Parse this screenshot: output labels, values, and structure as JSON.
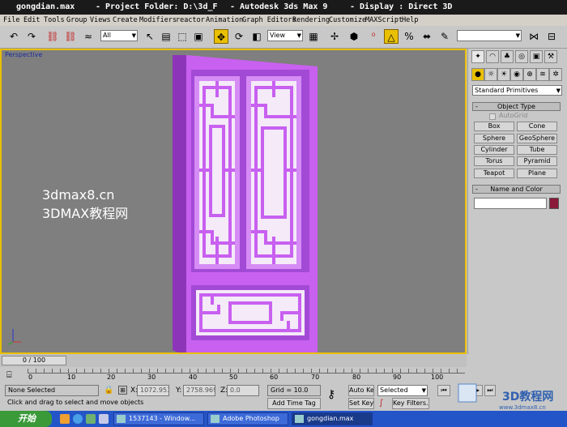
{
  "title": {
    "file": "gongdian.max",
    "project": "- Project Folder: D:\\3d_F",
    "app": "- Autodesk 3ds Max 9",
    "display": "- Display : Direct 3D"
  },
  "menu": [
    "File",
    "Edit",
    "Tools",
    "Group",
    "Views",
    "Create",
    "Modifiers",
    "reactor",
    "Animation",
    "Graph Editors",
    "Rendering",
    "Customize",
    "MAXScript",
    "Help"
  ],
  "toolbar": {
    "selection_filter": "All",
    "ref_coord": "View",
    "named_sel": ""
  },
  "viewport": {
    "label": "Perspective",
    "watermark_line1": "3dmax8.cn",
    "watermark_line2": "3DMAX教程网"
  },
  "command_panel": {
    "category": "Standard Primitives",
    "object_type_title": "Object Type",
    "autogrid_label": "AutoGrid",
    "buttons": [
      "Box",
      "Cone",
      "Sphere",
      "GeoSphere",
      "Cylinder",
      "Tube",
      "Torus",
      "Pyramid",
      "Teapot",
      "Plane"
    ],
    "name_color_title": "Name and Color",
    "object_color": "#8b1a3a"
  },
  "timeline": {
    "frame_label": "0 / 100",
    "ticks": [
      "0",
      "10",
      "20",
      "30",
      "40",
      "50",
      "60",
      "70",
      "80",
      "90",
      "100"
    ]
  },
  "status": {
    "selection": "None Selected",
    "prompt": "Click and drag to select and move objects",
    "x_label": "X:",
    "x_value": "1072.953",
    "y_label": "Y:",
    "y_value": "2758.969",
    "z_label": "Z:",
    "z_value": "0.0",
    "grid": "Grid = 10.0",
    "add_time_tag": "Add Time Tag",
    "auto_key": "Auto Key",
    "set_key": "Set Key",
    "key_mode": "Selected",
    "key_filters": "Key Filters..."
  },
  "taskbar": {
    "start": "开始",
    "tasks": [
      "1537143 - Window...",
      "Adobe Photoshop",
      "gongdian.max"
    ]
  },
  "colors": {
    "door": "#c860f0",
    "door_dark": "#9a3cc8",
    "viewport_bg": "#7f7f7f",
    "active_border": "#e8c000"
  }
}
